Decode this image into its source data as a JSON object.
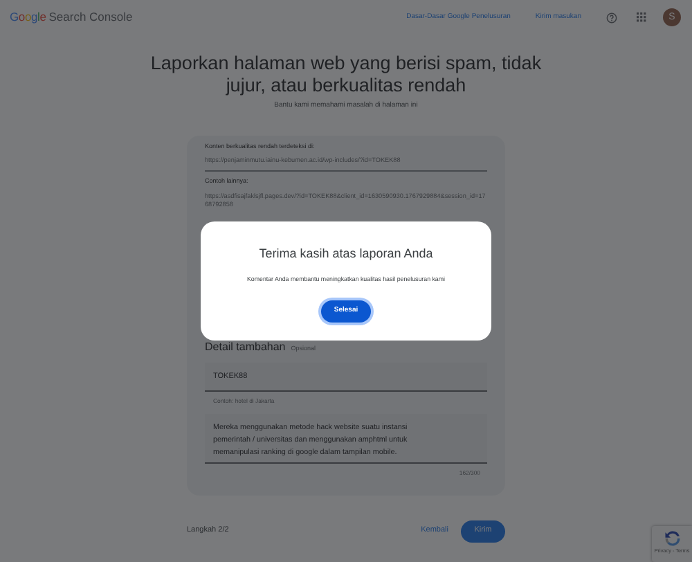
{
  "header": {
    "brand": "Google",
    "product": "Search Console",
    "links": [
      "Dasar-Dasar Google Penelusuran",
      "Kirim masukan"
    ],
    "avatar_letter": "S"
  },
  "page": {
    "title": "Laporkan halaman web yang berisi spam, tidak jujur, atau berkualitas rendah",
    "subtitle": "Bantu kami memahami masalah di halaman ini"
  },
  "report": {
    "detected_label": "Konten berkualitas rendah terdeteksi di:",
    "detected_url": "https://penjaminmutu.iainu-kebumen.ac.id/wp-includes/?id=TOKEK88",
    "more_label": "Contoh lainnya:",
    "more_url": "https://asdfisajfaklsjfl.pages.dev/?id=TOKEK88&client_id=1630590930.1767929884&session_id=1768792858"
  },
  "details": {
    "heading": "Detail tambahan",
    "optional": "Opsional",
    "field_value": "TOKEK88",
    "field_hint": "Contoh: hotel di Jakarta",
    "comment": "Mereka menggunakan metode hack website suatu instansi pemerintah / universitas dan menggunakan amphtml untuk memanipulasi ranking di google dalam tampilan mobile.",
    "counter": "162/300"
  },
  "footer": {
    "step": "Langkah 2/2",
    "back": "Kembali",
    "submit": "Kirim"
  },
  "recaptcha": {
    "text": "Privacy - Terms"
  },
  "dialog": {
    "title": "Terima kasih atas laporan Anda",
    "message": "Komentar Anda membantu meningkatkan kualitas hasil penelusuran kami",
    "button": "Selesai"
  }
}
